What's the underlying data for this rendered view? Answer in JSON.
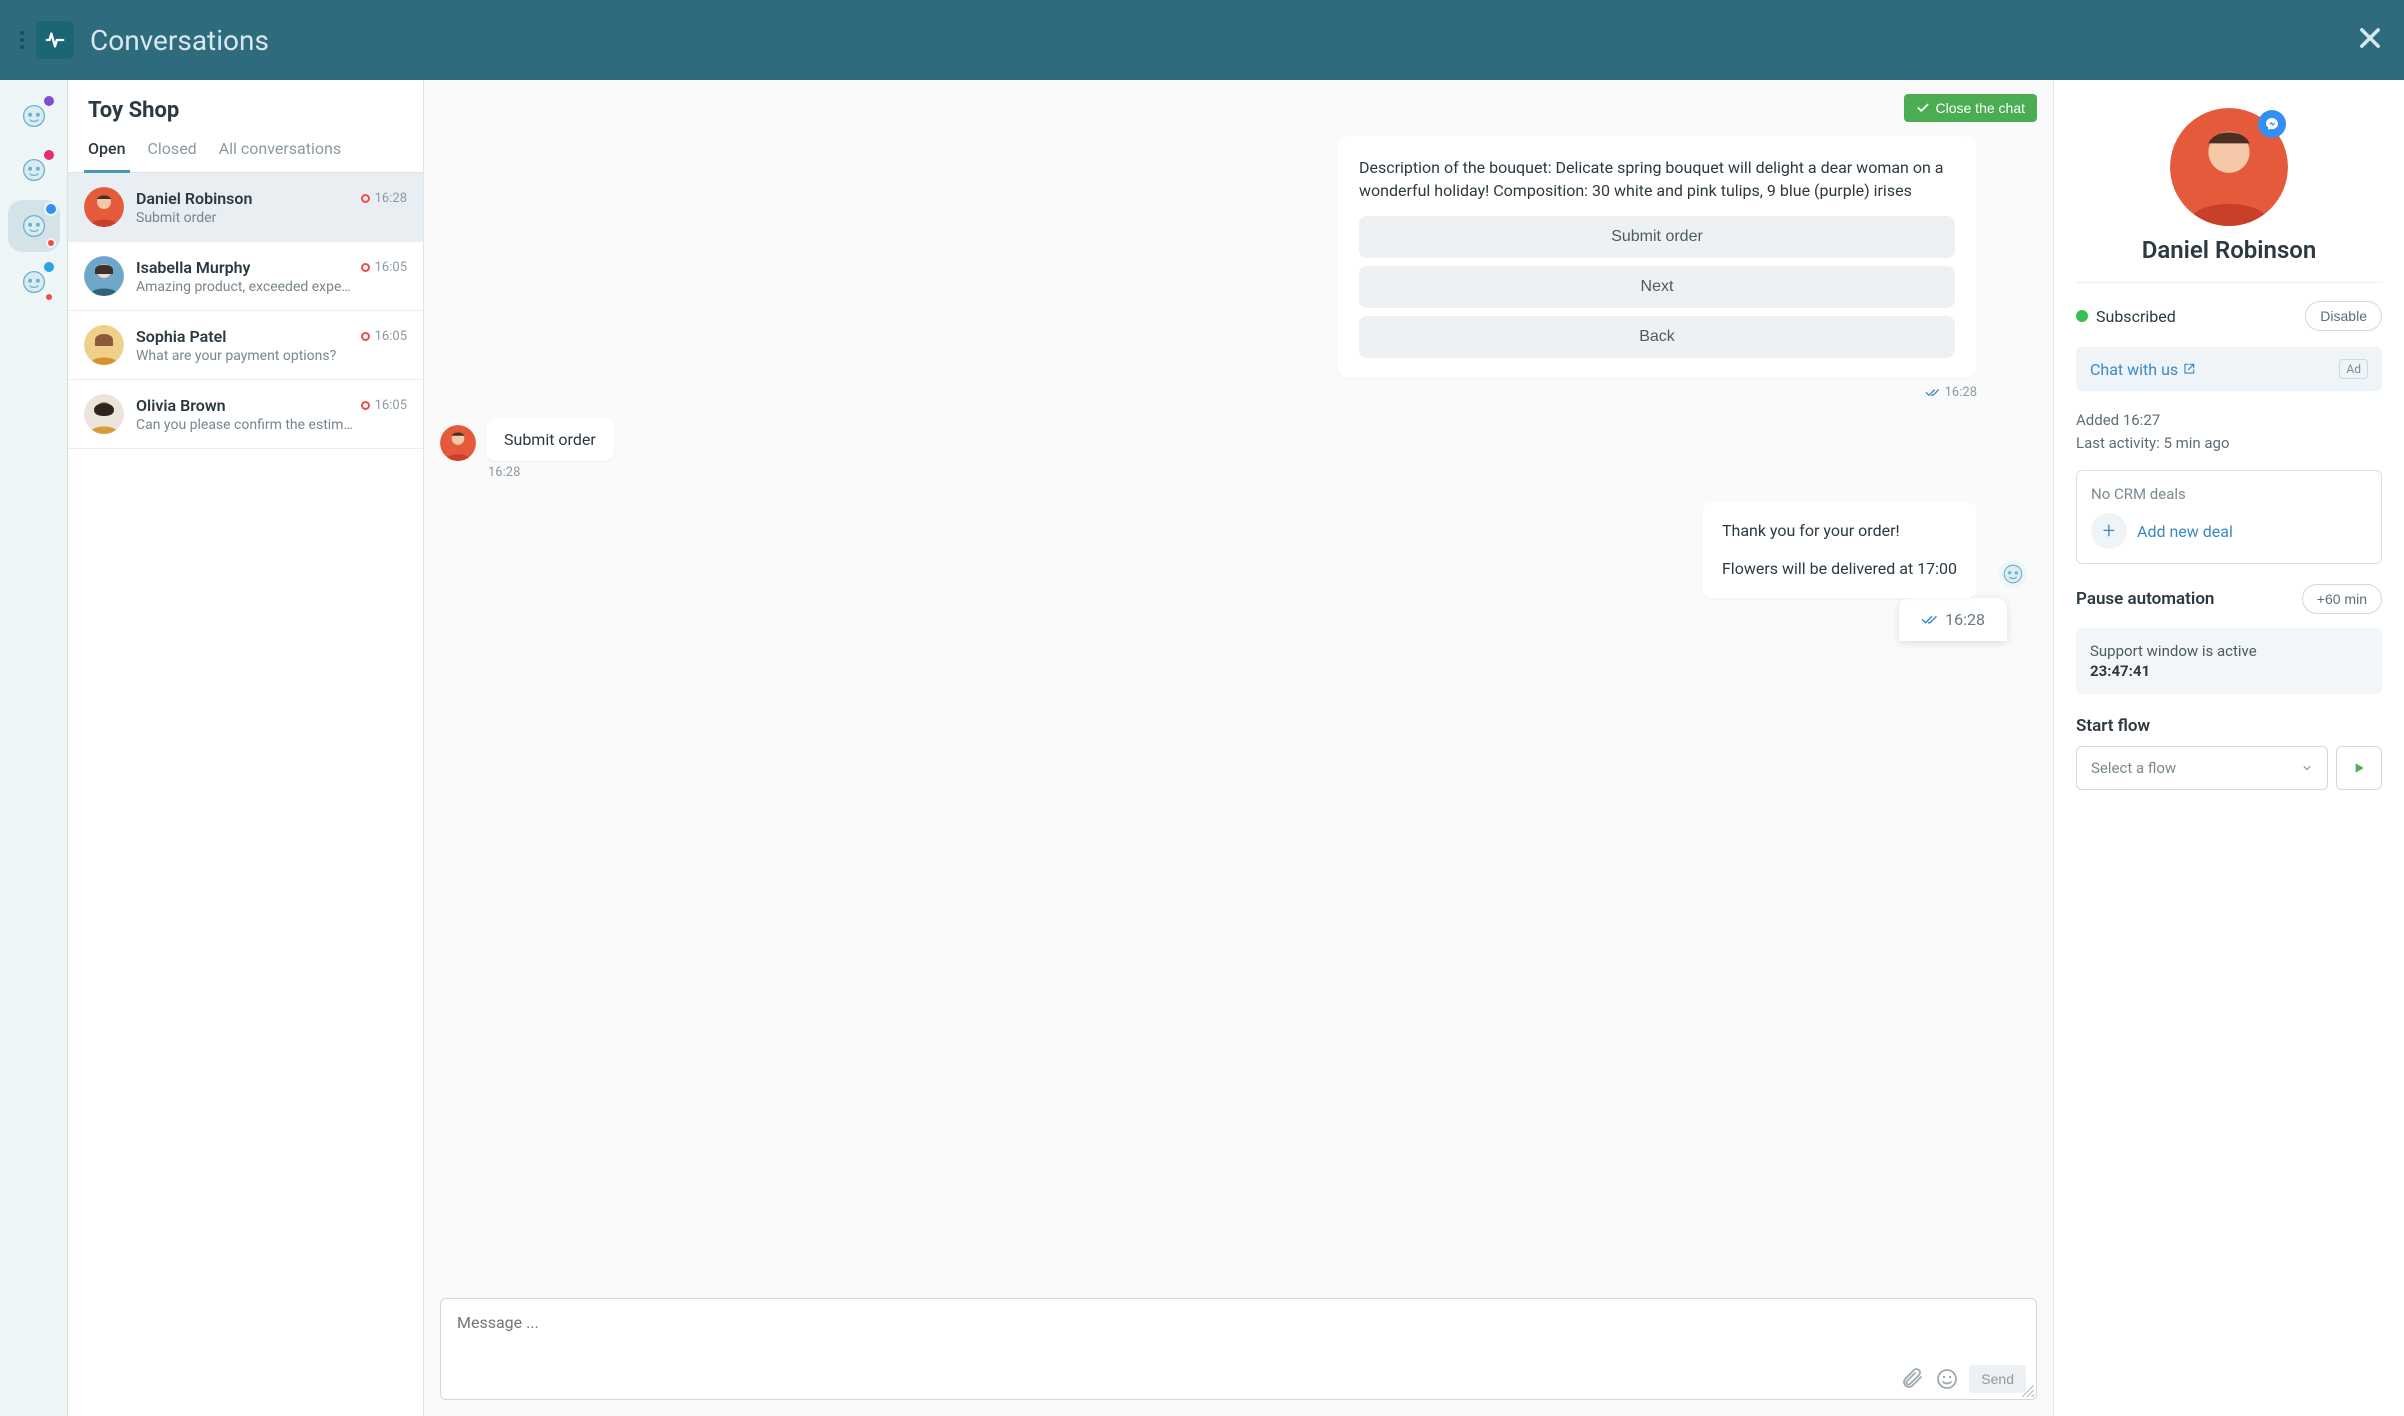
{
  "app": {
    "title": "Conversations"
  },
  "channels": [
    {
      "id": "viber",
      "badge_color": "#7e4fd0",
      "status_color": null
    },
    {
      "id": "instagram",
      "badge_color": "#e1306c",
      "status_color": null
    },
    {
      "id": "messenger",
      "badge_color": "#338ff1",
      "status_color": "#f24b4b",
      "active": true
    },
    {
      "id": "telegram",
      "badge_color": "#29a3e3",
      "status_color": "#f24b4b"
    }
  ],
  "conversationList": {
    "title": "Toy Shop",
    "tabs": {
      "open": "Open",
      "closed": "Closed",
      "all": "All conversations"
    },
    "items": [
      {
        "name": "Daniel Robinson",
        "preview": "Submit order",
        "time": "16:28",
        "active": true
      },
      {
        "name": "Isabella Murphy",
        "preview": "Amazing product, exceeded expe…",
        "time": "16:05"
      },
      {
        "name": "Sophia Patel",
        "preview": "What are your payment options?",
        "time": "16:05"
      },
      {
        "name": "Olivia Brown",
        "preview": "Can you please confirm the estim…",
        "time": "16:05"
      }
    ]
  },
  "chat": {
    "close_label": "Close the chat",
    "botCard": {
      "text": "Description of the bouquet: Delicate spring bouquet will delight a dear woman on a wonderful holiday! Composition: 30 white and pink tulips, 9 blue (purple) irises",
      "buttons": {
        "submit": "Submit order",
        "next": "Next",
        "back": "Back"
      },
      "time": "16:28"
    },
    "userMsg": {
      "text": "Submit order",
      "time": "16:28"
    },
    "botReply": {
      "line1": "Thank you for your order!",
      "line2": "Flowers will be delivered at 17:00",
      "time": "16:28"
    },
    "composer": {
      "placeholder": "Message ...",
      "send": "Send"
    }
  },
  "details": {
    "name": "Daniel Robinson",
    "subscribed": "Subscribed",
    "disable": "Disable",
    "chat_with_us": "Chat with us",
    "ad": "Ad",
    "added": "Added 16:27",
    "last_activity": "Last activity: 5 min ago",
    "no_deals": "No CRM deals",
    "add_deal": "Add new deal",
    "pause": "Pause automation",
    "pause_btn": "+60 min",
    "support_text": "Support window is active",
    "support_countdown": "23:47:41",
    "start_flow": "Start flow",
    "select_flow": "Select a flow"
  }
}
